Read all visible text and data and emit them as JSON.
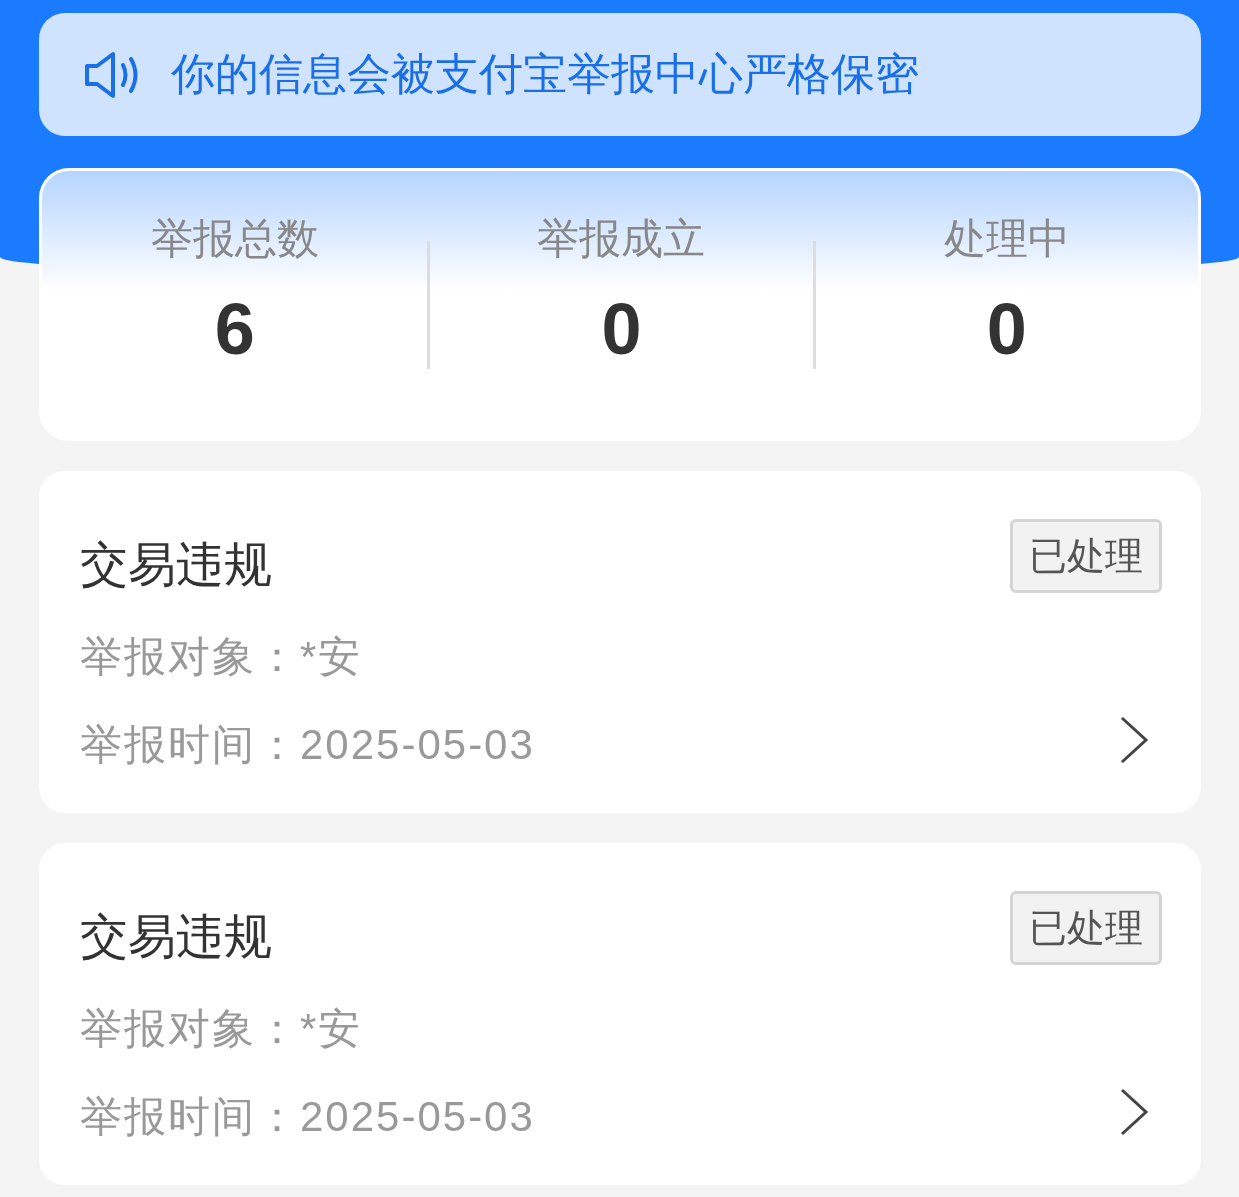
{
  "notice": {
    "text": "你的信息会被支付宝举报中心严格保密"
  },
  "stats": [
    {
      "label": "举报总数",
      "value": "6"
    },
    {
      "label": "举报成立",
      "value": "0"
    },
    {
      "label": "处理中",
      "value": "0"
    }
  ],
  "reports": [
    {
      "title": "交易违规",
      "status": "已处理",
      "lines": [
        "举报对象：*安",
        "举报时间：2025-05-03"
      ]
    },
    {
      "title": "交易违规",
      "status": "已处理",
      "lines": [
        "举报对象：*安",
        "举报时间：2025-05-03"
      ]
    }
  ]
}
